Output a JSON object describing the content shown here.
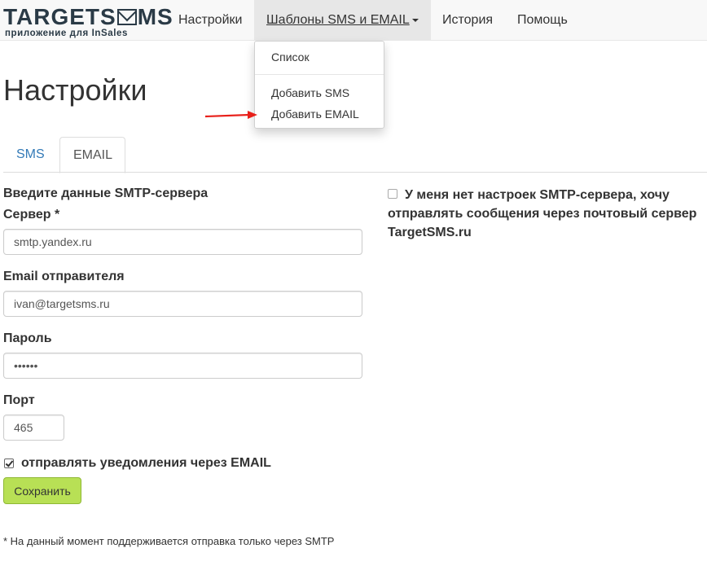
{
  "brand": {
    "name_a": "TARGETS",
    "name_b": "MS",
    "tagline": "приложение для InSales"
  },
  "nav": {
    "items": [
      {
        "label": "Настройки"
      },
      {
        "label": "Шаблоны SMS и EMAIL"
      },
      {
        "label": "История"
      },
      {
        "label": "Помощь"
      }
    ],
    "dropdown": {
      "list": "Список",
      "add_sms": "Добавить SMS",
      "add_email": "Добавить EMAIL"
    }
  },
  "page": {
    "title": "Настройки"
  },
  "tabs": {
    "sms": "SMS",
    "email": "EMAIL"
  },
  "form": {
    "section_title": "Введите данные SMTP-сервера",
    "server_label": "Сервер *",
    "server_value": "smtp.yandex.ru",
    "email_label": "Email отправителя",
    "email_value": "ivan@targetsms.ru",
    "password_label": "Пароль",
    "password_value": "••••••",
    "port_label": "Порт",
    "port_value": "465",
    "notify_label": "отправлять уведомления через EMAIL",
    "notify_checked": true,
    "save_label": "Сохранить"
  },
  "no_smtp_option": {
    "label": "У меня нет настроек SMTP-сервера, хочу отправлять сообщения через почтовый сервер TargetSMS.ru",
    "checked": false
  },
  "footnote": "* На данный момент поддерживается отправка только через SMTP",
  "colors": {
    "save_button": "#b8e055",
    "link": "#337ab7",
    "arrow": "#e8201a"
  },
  "icons": [
    "envelope-icon",
    "caret-down-icon",
    "arrow-right-icon",
    "checkbox-icon"
  ]
}
